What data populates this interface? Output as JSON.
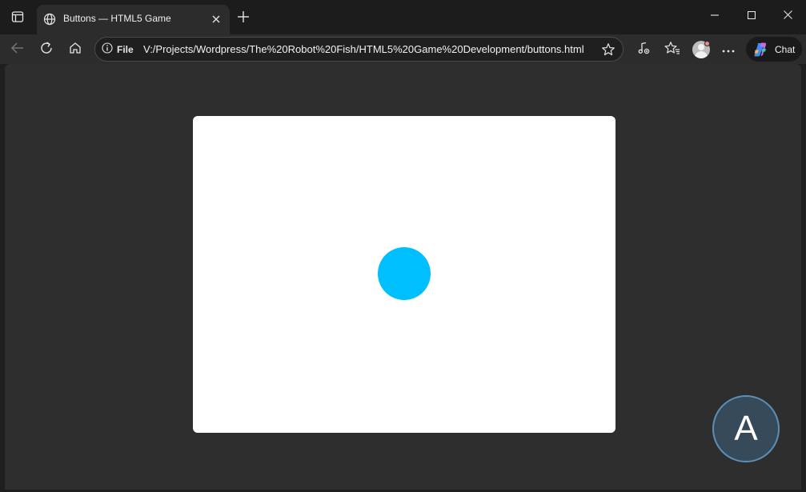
{
  "browser": {
    "tab": {
      "title": "Buttons — HTML5 Game",
      "favicon": "globe-icon"
    },
    "address_bar": {
      "site_info_label": "File",
      "url": "V:/Projects/Wordpress/The%20Robot%20Fish/HTML5%20Game%20Development/buttons.html"
    },
    "chat_label": "Chat"
  },
  "game": {
    "player_color": "#00bfff",
    "action_button_label": "A"
  },
  "colors": {
    "page_background": "#2e2e2e",
    "canvas_background": "#ffffff",
    "action_button_fill": "#374a59",
    "action_button_border": "#5d8fb6"
  }
}
